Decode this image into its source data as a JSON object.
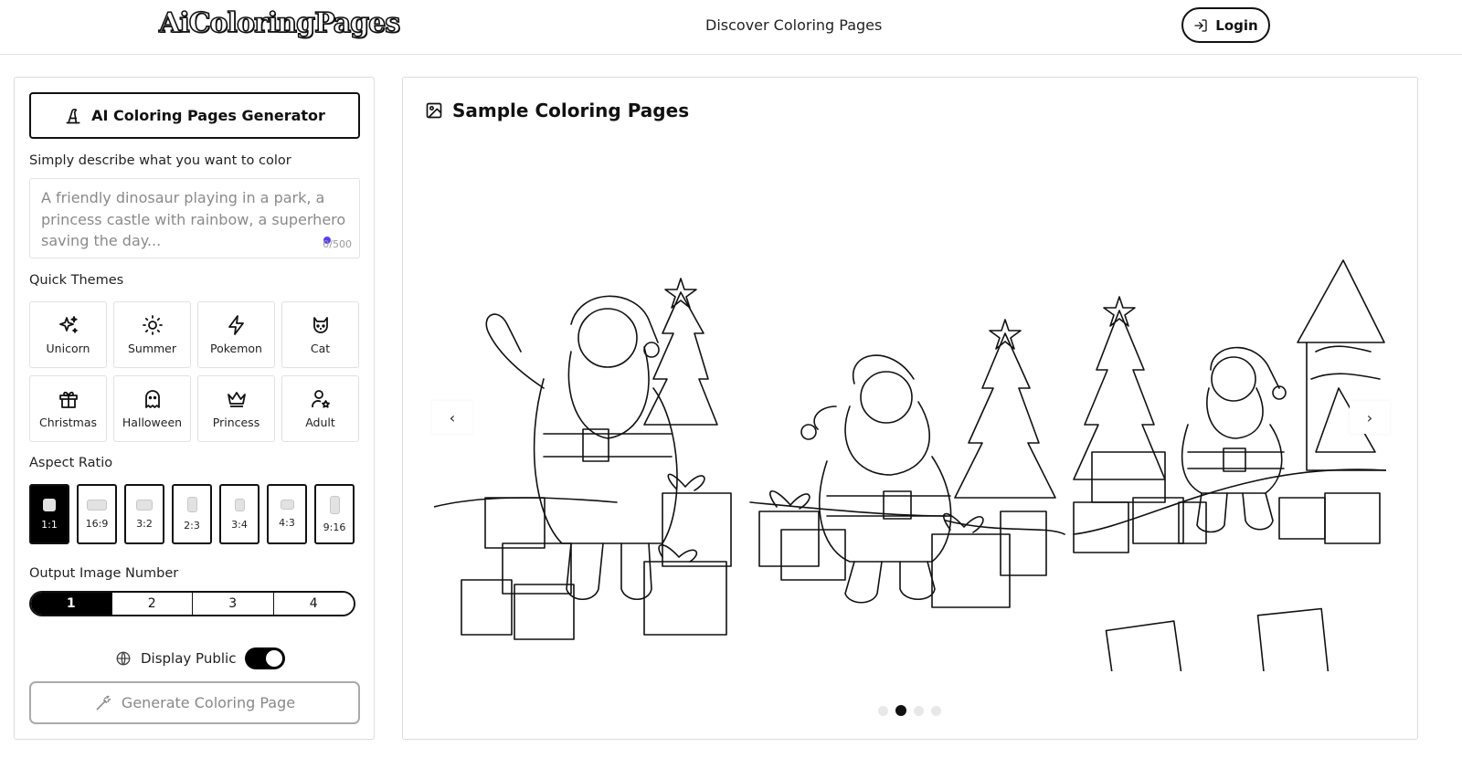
{
  "header": {
    "logo_text": "AiColoringPages",
    "nav_discover": "Discover Coloring Pages",
    "login_label": "Login"
  },
  "generator": {
    "title": "AI Coloring Pages Generator",
    "prompt_label": "Simply describe what you want to color",
    "prompt_placeholder": "A friendly dinosaur playing in a park, a princess castle with rainbow, a superhero saving the day...",
    "prompt_value": "",
    "char_counter": "0/500",
    "themes_label": "Quick Themes",
    "themes": [
      {
        "label": "Unicorn",
        "icon": "sparkles-icon"
      },
      {
        "label": "Summer",
        "icon": "sun-icon"
      },
      {
        "label": "Pokemon",
        "icon": "lightning-icon"
      },
      {
        "label": "Cat",
        "icon": "cat-icon"
      },
      {
        "label": "Christmas",
        "icon": "gift-icon"
      },
      {
        "label": "Halloween",
        "icon": "ghost-icon"
      },
      {
        "label": "Princess",
        "icon": "crown-icon"
      },
      {
        "label": "Adult",
        "icon": "user-star-icon"
      }
    ],
    "aspect_label": "Aspect Ratio",
    "aspect_ratios": [
      "1:1",
      "16:9",
      "3:2",
      "2:3",
      "3:4",
      "4:3",
      "9:16"
    ],
    "aspect_selected": "1:1",
    "output_label": "Output Image Number",
    "output_numbers": [
      "1",
      "2",
      "3",
      "4"
    ],
    "output_selected": "1",
    "display_public_label": "Display Public",
    "display_public_on": true,
    "generate_label": "Generate Coloring Page"
  },
  "samples": {
    "title": "Sample Coloring Pages",
    "slide_count": 4,
    "active_slide": 2
  },
  "colors": {
    "accent": "#000000",
    "counter_dot": "#5b3df5"
  }
}
